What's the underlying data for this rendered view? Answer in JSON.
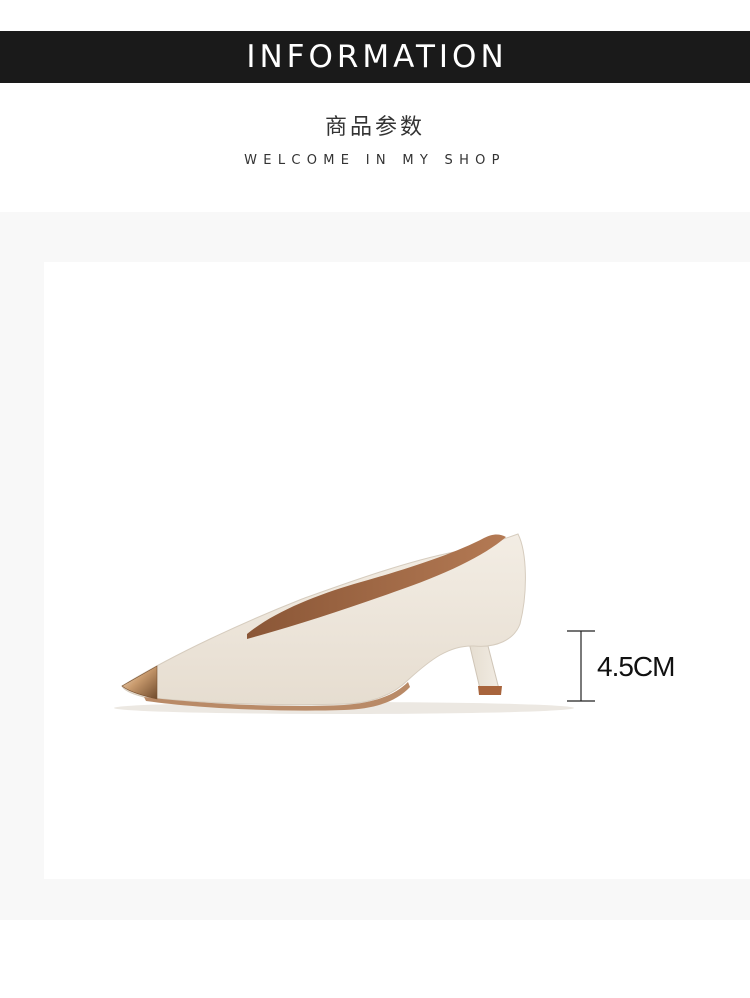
{
  "header": {
    "title": "INFORMATION",
    "subtitle_cn": "商品参数",
    "subtitle_en": "WELCOME IN MY SHOP"
  },
  "product": {
    "image_icon": "pump-shoe-icon",
    "heel_height_label": "4.5CM"
  },
  "colors": {
    "banner": "#1a1a1a",
    "panel": "#f8f8f8",
    "shoe_leather": "#efe8de",
    "shoe_lining": "#a06a48",
    "toe_cap": "#c9a47c"
  }
}
